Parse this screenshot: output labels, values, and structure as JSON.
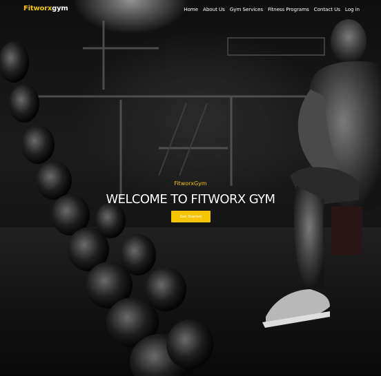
{
  "brand": {
    "name_prefix": "Fitworx",
    "name_suffix": "gym",
    "accent_color": "#f6c400"
  },
  "nav": {
    "items": [
      {
        "label": "Home"
      },
      {
        "label": "About Us"
      },
      {
        "label": "Gym Services"
      },
      {
        "label": "Fitness Programs"
      },
      {
        "label": "Contact Us"
      },
      {
        "label": "Log in"
      }
    ]
  },
  "hero": {
    "kicker": "FitworxGym",
    "headline": "WELCOME TO FITWORX GYM",
    "cta_label": "Get Started",
    "background_image": "gym-athlete-photo"
  }
}
